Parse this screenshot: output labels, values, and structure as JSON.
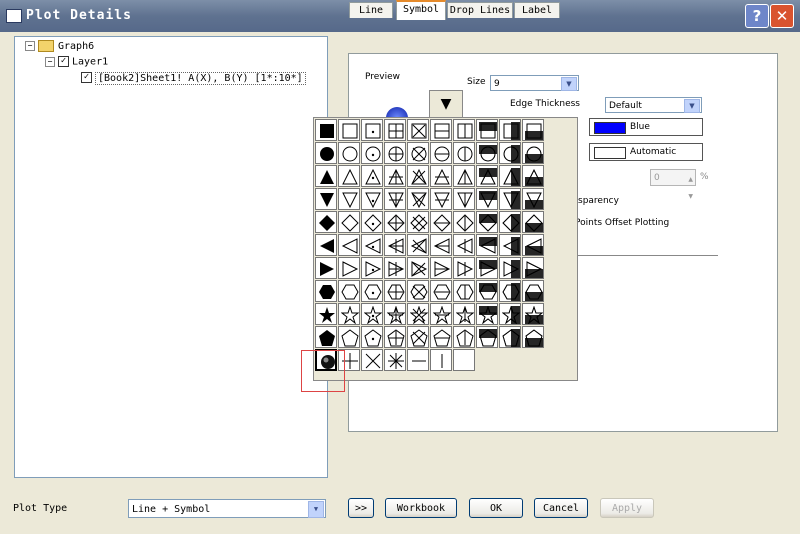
{
  "window": {
    "title": "Plot Details",
    "help_glyph": "?",
    "close_glyph": "✕"
  },
  "tree": {
    "root": "Graph6",
    "layer": "Layer1",
    "plot": "[Book2]Sheet1! A(X), B(Y) [1*:10*]"
  },
  "tabs": [
    {
      "label": "Line"
    },
    {
      "label": "Symbol"
    },
    {
      "label": "Drop Lines"
    },
    {
      "label": "Label"
    }
  ],
  "symbol_tab": {
    "preview_label": "Preview",
    "size_label": "Size",
    "size_value": "9",
    "edge_thickness_label": "Edge Thickness",
    "edge_thickness_value": "Default",
    "edge_color_label": "Blue",
    "edge_color": "#0000ff",
    "fill_color_label": "Automatic",
    "transparency_label": "sparency",
    "transparency_value": "0",
    "percent": "%",
    "offset_label": "Points Offset Plotting"
  },
  "palette": {
    "rows": 11,
    "cols": 10,
    "selected": "sphere"
  },
  "bottom": {
    "plot_type_label": "Plot Type",
    "plot_type_value": "Line + Symbol",
    "expand_label": ">>",
    "workbook_label": "Workbook",
    "ok_label": "OK",
    "cancel_label": "Cancel",
    "apply_label": "Apply"
  }
}
